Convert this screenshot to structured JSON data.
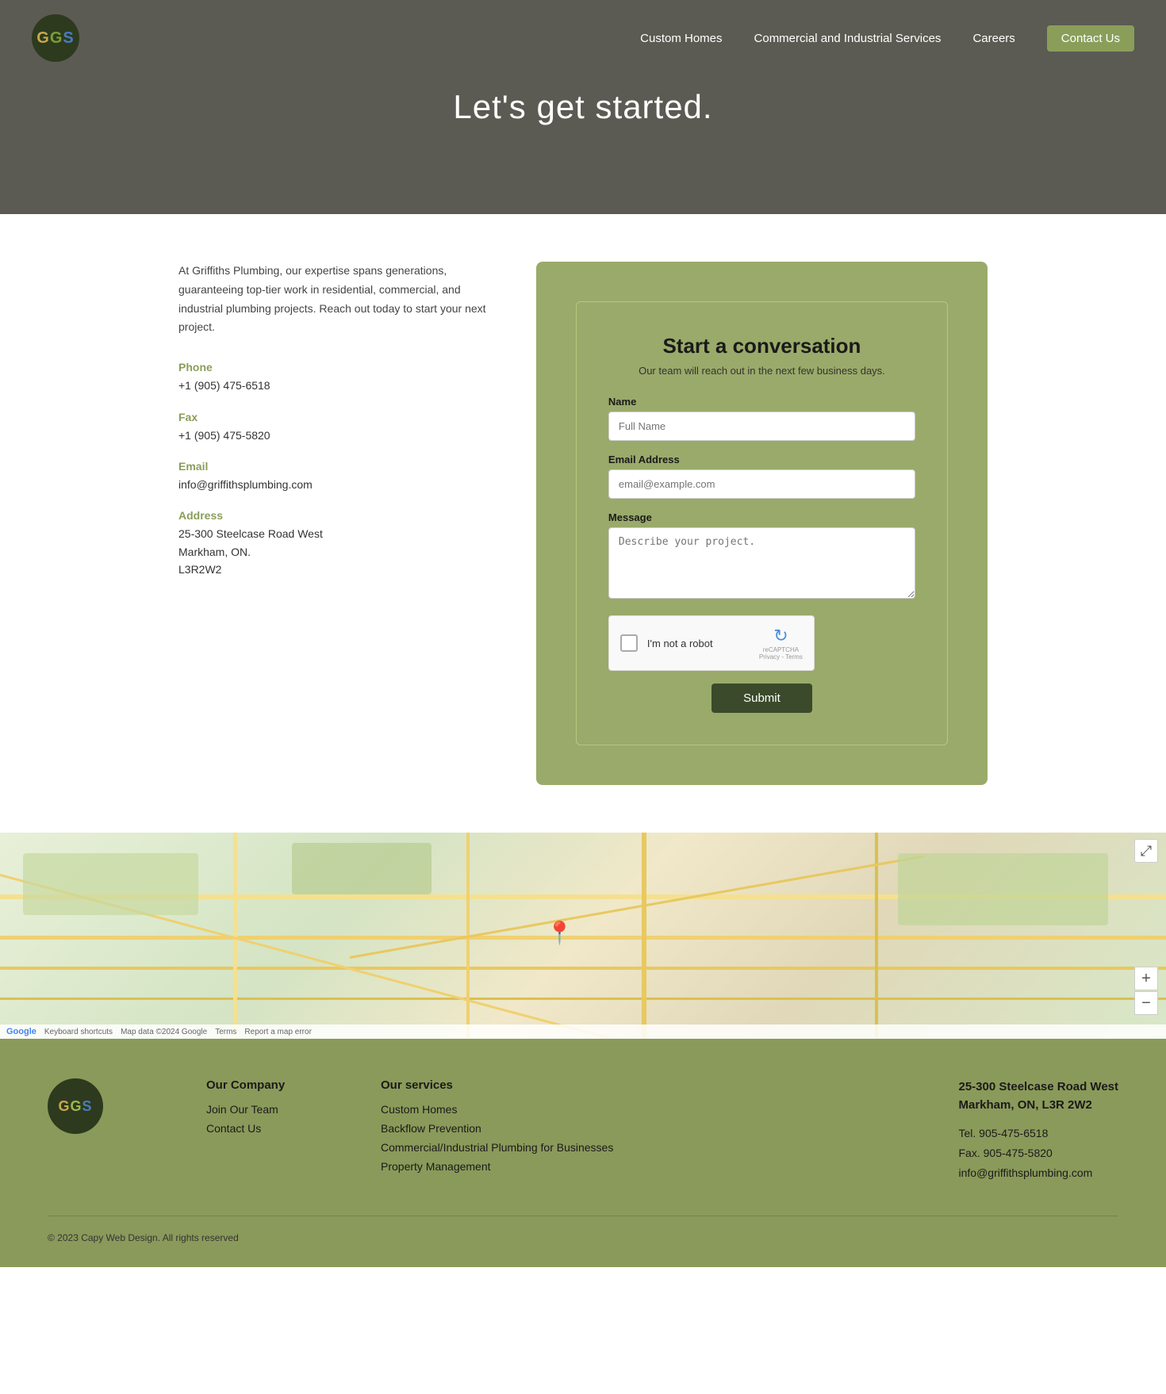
{
  "nav": {
    "logo_text": "GGS",
    "links": [
      {
        "label": "Custom Homes",
        "href": "#",
        "active": false
      },
      {
        "label": "Commercial and Industrial Services",
        "href": "#",
        "active": false
      },
      {
        "label": "Careers",
        "href": "#",
        "active": false
      },
      {
        "label": "Contact Us",
        "href": "#",
        "active": true
      }
    ]
  },
  "hero": {
    "heading": "Let's get started."
  },
  "contact_info": {
    "intro": "At Griffiths Plumbing, our expertise spans generations, guaranteeing top-tier work in residential, commercial, and industrial plumbing projects. Reach out today to start your next project.",
    "phone_label": "Phone",
    "phone_value": "+1 (905) 475-6518",
    "fax_label": "Fax",
    "fax_value": "+1 (905) 475-5820",
    "email_label": "Email",
    "email_value": "info@griffithsplumbing.com",
    "address_label": "Address",
    "address_line1": "25-300 Steelcase Road West",
    "address_line2": "Markham, ON.",
    "address_line3": "L3R2W2"
  },
  "form": {
    "title": "Start a conversation",
    "subtitle": "Our team will reach out in the next few business days.",
    "name_label": "Name",
    "name_placeholder": "Full Name",
    "email_label": "Email Address",
    "email_placeholder": "email@example.com",
    "message_label": "Message",
    "message_placeholder": "Describe your project.",
    "recaptcha_label": "I'm not a robot",
    "recaptcha_privacy": "Privacy",
    "recaptcha_terms": "Terms",
    "submit_label": "Submit"
  },
  "map": {
    "footer_text": "Keyboard shortcuts",
    "map_data": "Map data ©2024 Google",
    "terms": "Terms",
    "report": "Report a map error"
  },
  "footer": {
    "logo_text": "GGS",
    "company_col": {
      "title": "Our Company",
      "links": [
        "Join Our Team",
        "Contact Us"
      ]
    },
    "services_col": {
      "title": "Our services",
      "links": [
        "Custom Homes",
        "Backflow Prevention",
        "Commercial/Industrial Plumbing for Businesses",
        "Property Management"
      ]
    },
    "address_col": {
      "line1": "25-300 Steelcase Road West",
      "line2": "Markham, ON, L3R 2W2",
      "tel": "Tel. 905-475-6518",
      "fax": "Fax. 905-475-5820",
      "email": "info@griffithsplumbing.com"
    },
    "copyright": "© 2023 Capy Web Design. All rights reserved"
  }
}
